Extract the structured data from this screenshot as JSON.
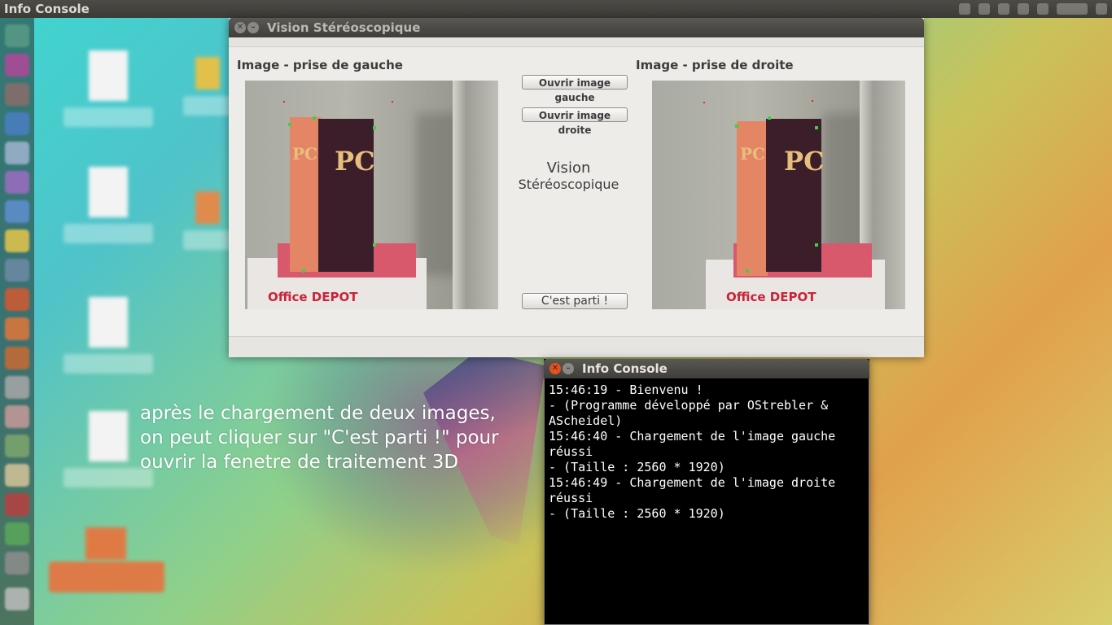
{
  "top_panel": {
    "app_title": "Info Console"
  },
  "main_window": {
    "title": "Vision Stéréoscopique",
    "left_label": "Image - prise de gauche",
    "right_label": "Image - prise de droite",
    "open_left_button": "Ouvrir image gauche",
    "open_right_button": "Ouvrir image droite",
    "center_title_line1": "Vision",
    "center_title_line2": "Stéréoscopique",
    "go_button": "C'est parti !",
    "photo_box_brand": "Office DEPOT",
    "photo_book_title": "PC"
  },
  "annotation": {
    "line1": "après le chargement de deux images,",
    "line2": "on peut cliquer sur \"C'est parti !\" pour",
    "line3": "ouvrir la fenetre de traitement 3D"
  },
  "console_window": {
    "title": "Info Console",
    "lines": [
      "15:46:19 - Bienvenu !",
      "- (Programme développé par OStrebler &",
      "AScheidel)",
      "15:46:40 - Chargement de l'image gauche",
      "réussi",
      "- (Taille : 2560 * 1920)",
      "15:46:49 - Chargement de l'image droite",
      "réussi",
      "- (Taille : 2560 * 1920)"
    ]
  },
  "icons": {
    "close": "close-icon",
    "minimize": "minimize-icon"
  },
  "colors": {
    "panel": "#3c3b37",
    "close_button_active": "#e2521f",
    "window_bg": "#edece9",
    "console_bg": "#000000"
  }
}
